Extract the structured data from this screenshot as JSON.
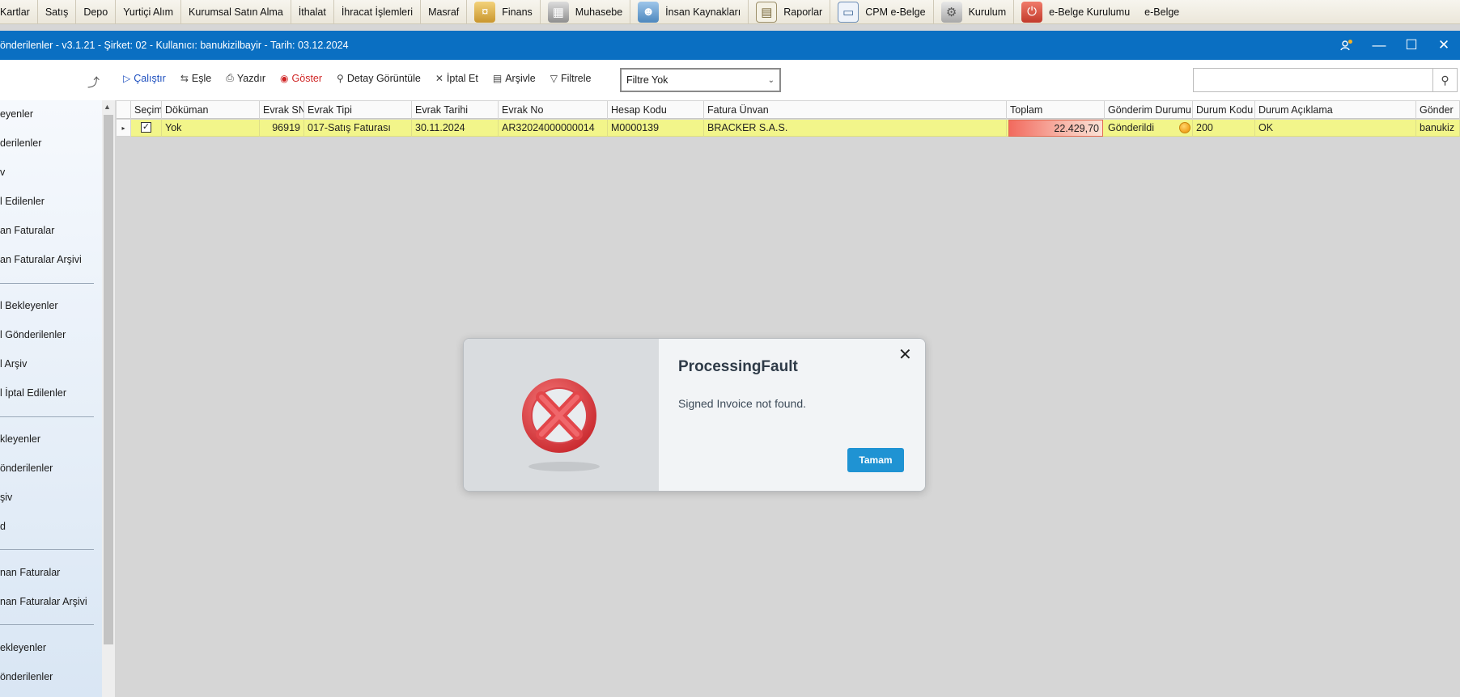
{
  "menu": {
    "items": [
      {
        "label": "Kartlar",
        "icon": null
      },
      {
        "label": "Satış",
        "icon": null
      },
      {
        "label": "Depo",
        "icon": null
      },
      {
        "label": "Yurtiçi Alım",
        "icon": null
      },
      {
        "label": "Kurumsal Satın Alma",
        "icon": null
      },
      {
        "label": "İthalat",
        "icon": null
      },
      {
        "label": "İhracat İşlemleri",
        "icon": null
      },
      {
        "label": "Masraf",
        "icon": null
      },
      {
        "label": "Finans",
        "icon": "coins-icon"
      },
      {
        "label": "Muhasebe",
        "icon": "calculator-icon"
      },
      {
        "label": "İnsan Kaynakları",
        "icon": "people-icon"
      },
      {
        "label": "Raporlar",
        "icon": "report-icon"
      },
      {
        "label": "CPM e-Belge",
        "icon": "document-icon"
      },
      {
        "label": "Kurulum",
        "icon": "gear-icon"
      },
      {
        "label": "e-Belge Kurulumu",
        "icon": "power-icon"
      },
      {
        "label": "e-Belge",
        "icon": null
      }
    ]
  },
  "window": {
    "title": "önderilenler - v3.1.21 - Şirket: 02 - Kullanıcı: banukizilbayir - Tarih: 03.12.2024"
  },
  "toolbar": {
    "run": "Çalıştır",
    "match": "Eşle",
    "print": "Yazdır",
    "show": "Göster",
    "detail": "Detay Görüntüle",
    "cancel": "İptal Et",
    "archive": "Arşivle",
    "filter": "Filtrele",
    "filter_select_value": "Filtre Yok",
    "search_placeholder": ""
  },
  "sidebar": {
    "items": [
      {
        "label": "eyenler"
      },
      {
        "label": "derilenler"
      },
      {
        "label": "v"
      },
      {
        "label": "l Edilenler"
      },
      {
        "label": "an Faturalar"
      },
      {
        "label": "an Faturalar Arşivi"
      },
      {
        "label": "l Bekleyenler"
      },
      {
        "label": "l Gönderilenler"
      },
      {
        "label": "l Arşiv"
      },
      {
        "label": "l İptal Edilenler"
      },
      {
        "label": "kleyenler"
      },
      {
        "label": "önderilenler"
      },
      {
        "label": "şiv"
      },
      {
        "label": "d"
      },
      {
        "label": "nan Faturalar"
      },
      {
        "label": "nan Faturalar Arşivi"
      },
      {
        "label": "ekleyenler"
      },
      {
        "label": "önderilenler"
      }
    ]
  },
  "grid": {
    "columns": [
      "Seçim",
      "Döküman",
      "Evrak SN",
      "Evrak Tipi",
      "Evrak Tarihi",
      "Evrak No",
      "Hesap Kodu",
      "Fatura Ünvan",
      "Toplam",
      "Gönderim Durumu",
      "Durum Kodu",
      "Durum Açıklama",
      "Gönder"
    ],
    "rows": [
      {
        "selected": "✓",
        "dokuman": "Yok",
        "evrak_sn": "96919",
        "evrak_tipi": "017-Satış Faturası",
        "evrak_tarihi": "30.11.2024",
        "evrak_no": "AR32024000000014",
        "hesap_kodu": "M0000139",
        "fatura_unvan": "BRACKER S.A.S.",
        "toplam": "22.429,70",
        "gonderim_durumu": "Gönderildi",
        "durum_kodu": "200",
        "durum_aciklama": "OK",
        "gonderen": "banukiz"
      }
    ]
  },
  "dialog": {
    "title": "ProcessingFault",
    "message": "Signed Invoice not found.",
    "ok_label": "Tamam",
    "icon": "error-x-icon"
  },
  "colors": {
    "titlebar": "#0a6fc2",
    "selected_row": "#f2f58a",
    "ok_button": "#1f93d3",
    "error_icon": "#e2464a"
  }
}
